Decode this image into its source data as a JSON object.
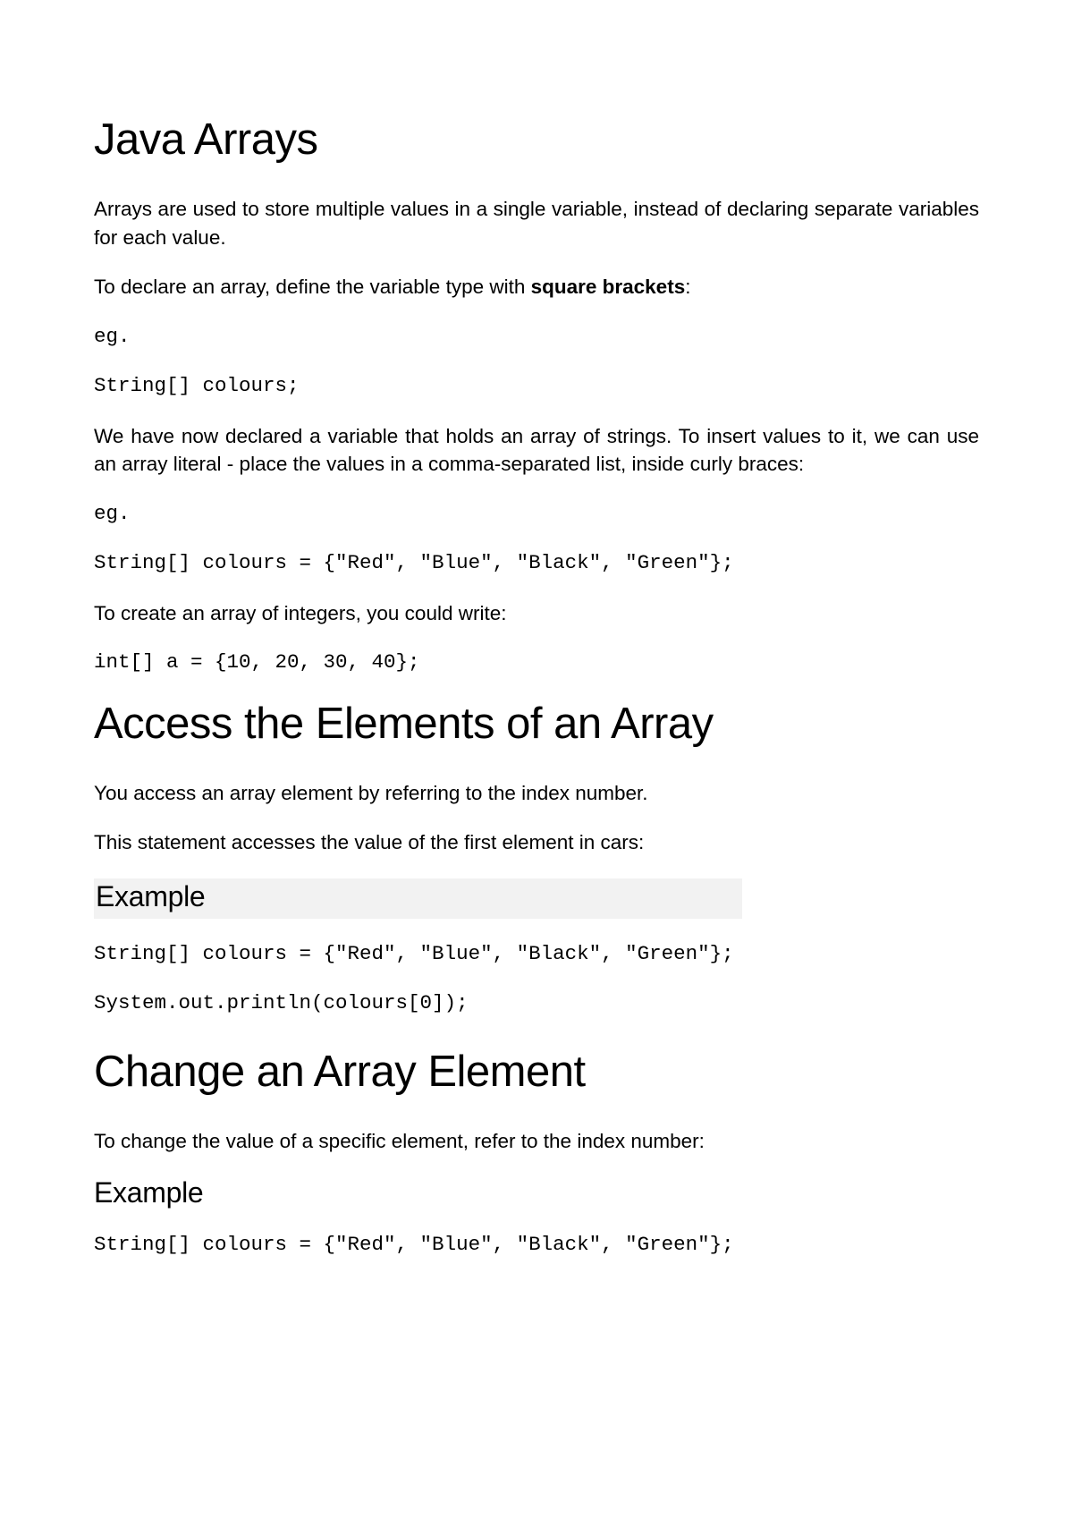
{
  "section1": {
    "title": "Java Arrays",
    "para1": "Arrays are used to store multiple values in a single variable, instead of declaring separate variables for each value.",
    "para2_pre": "To declare an array, define the variable type with ",
    "para2_bold": "square brackets",
    "para2_post": ":",
    "eg1": "eg.",
    "code1": "String[] colours;",
    "para3": "We have now declared a variable that holds an array of strings. To insert values to it, we can use an array literal - place the values in a comma-separated list, inside curly braces:",
    "eg2": "eg.",
    "code2": "String[] colours = {\"Red\", \"Blue\", \"Black\", \"Green\"};",
    "para4": "To create an array of integers, you could write:",
    "code3": "int[] a = {10, 20, 30, 40};"
  },
  "section2": {
    "title": "Access the Elements of an Array",
    "para1": "You access an array element by referring to the index number.",
    "para2": "This statement accesses the value of the first element in cars:",
    "example_label": "Example",
    "code1": "String[] colours = {\"Red\", \"Blue\", \"Black\", \"Green\"};",
    "code2": "System.out.println(colours[0]);"
  },
  "section3": {
    "title": "Change an Array Element",
    "para1": "To change the value of a specific element, refer to the index number:",
    "example_label": "Example",
    "code1": "String[] colours = {\"Red\", \"Blue\", \"Black\", \"Green\"};"
  }
}
